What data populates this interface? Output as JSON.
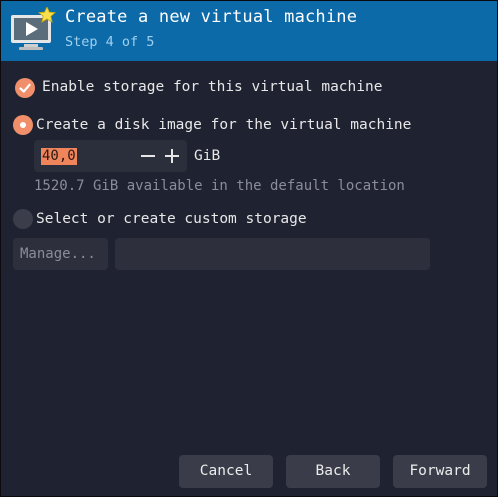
{
  "header": {
    "title": "Create a new virtual machine",
    "subtitle": "Step 4 of 5",
    "icon": "vm-monitor-play-icon"
  },
  "storage": {
    "enable_label": "Enable storage for this virtual machine",
    "enable_checked": true,
    "disk_image_label": "Create a disk image for the virtual machine",
    "disk_image_selected": true,
    "disk_size_value": "40,0",
    "disk_size_unit": "GiB",
    "available_hint": "1520.7 GiB available in the default location",
    "custom_label": "Select or create custom storage",
    "custom_selected": false,
    "manage_label": "Manage...",
    "custom_path_value": ""
  },
  "buttons": {
    "cancel": "Cancel",
    "back": "Back",
    "forward": "Forward"
  },
  "colors": {
    "header_bg": "#0d6aa8",
    "accent": "#f08f6a",
    "background": "#1f2230"
  }
}
